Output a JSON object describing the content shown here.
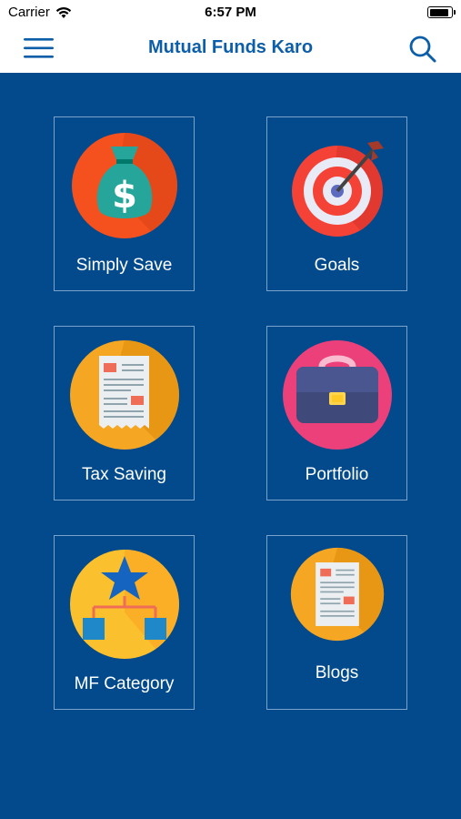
{
  "status_bar": {
    "carrier": "Carrier",
    "time": "6:57 PM",
    "battery_level": 0.95
  },
  "nav": {
    "title": "Mutual Funds Karo",
    "menu_icon": "hamburger-menu-icon",
    "search_icon": "search-icon"
  },
  "colors": {
    "background": "#034a8c",
    "title": "#0d5ea8",
    "tile_border": "#7aa3cc"
  },
  "tiles": [
    {
      "label": "Simply Save",
      "icon": "money-bag-icon"
    },
    {
      "label": "Goals",
      "icon": "target-icon"
    },
    {
      "label": "Tax Saving",
      "icon": "receipt-icon"
    },
    {
      "label": "Portfolio",
      "icon": "briefcase-icon"
    },
    {
      "label": "MF Category",
      "icon": "hierarchy-star-icon"
    },
    {
      "label": "Blogs",
      "icon": "document-icon"
    }
  ]
}
